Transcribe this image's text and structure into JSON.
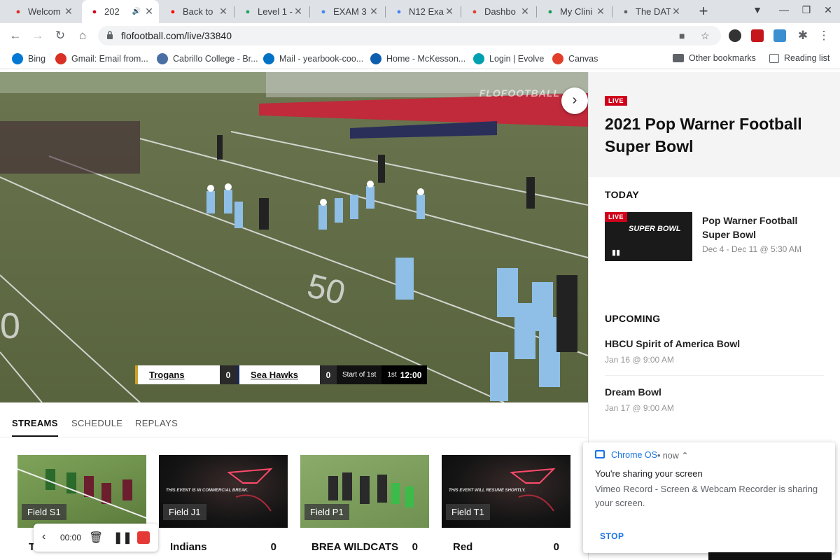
{
  "browser": {
    "tabs": [
      {
        "title": "Welcom",
        "favicon": "gmail-icon",
        "color": "#d93025"
      },
      {
        "title": "202",
        "favicon": "flosports-icon",
        "color": "#d0021b",
        "active": true,
        "audio": true
      },
      {
        "title": "Back to",
        "favicon": "youtube-icon",
        "color": "#ff0000"
      },
      {
        "title": "Level 1 -",
        "favicon": "drive-icon",
        "color": "#1fa463"
      },
      {
        "title": "EXAM 3",
        "favicon": "docs-icon",
        "color": "#4285f4"
      },
      {
        "title": "N12 Exa",
        "favicon": "docs-icon",
        "color": "#4285f4"
      },
      {
        "title": "Dashbo",
        "favicon": "canvas-icon",
        "color": "#e13f2b"
      },
      {
        "title": "My Clini",
        "favicon": "sheets-icon",
        "color": "#0f9d58"
      },
      {
        "title": "The DAT",
        "favicon": "globe-icon",
        "color": "#5f6368"
      }
    ],
    "new_tab_label": "+",
    "url": "flofootball.com/live/33840",
    "bookmarks": [
      {
        "label": "Bing",
        "icon": "bing-icon",
        "color": "#0078d4"
      },
      {
        "label": "Gmail: Email from...",
        "icon": "gmail-icon",
        "color": "#d93025"
      },
      {
        "label": "Cabrillo College - Br...",
        "icon": "cabrillo-icon",
        "color": "#4a6fa5"
      },
      {
        "label": "Mail - yearbook-coo...",
        "icon": "outlook-icon",
        "color": "#0072c6"
      },
      {
        "label": "Home - McKesson...",
        "icon": "mckesson-icon",
        "color": "#0d5eaf"
      },
      {
        "label": "Login | Evolve",
        "icon": "evolve-icon",
        "color": "#00a0b0"
      },
      {
        "label": "Canvas",
        "icon": "canvas-icon",
        "color": "#e13f2b"
      }
    ],
    "other_bookmarks": "Other bookmarks",
    "reading_list": "Reading list"
  },
  "video": {
    "watermark": "FLOFOOTBALL",
    "scorebug": {
      "team1": "Trogans",
      "score1": "0",
      "team2": "Sea Hawks",
      "score2": "0",
      "status": "Start of 1st",
      "period": "1st",
      "clock": "12:00"
    }
  },
  "panel": {
    "live_label": "LIVE",
    "event_title": "2021 Pop Warner Football Super Bowl",
    "today_label": "TODAY",
    "today_event": {
      "live_label": "LIVE",
      "thumb_text": "SUPER BOWL",
      "title": "Pop Warner Football Super Bowl",
      "date": "Dec 4 - Dec 11 @ 5:30 AM"
    },
    "upcoming_label": "UPCOMING",
    "upcoming": [
      {
        "title": "HBCU Spirit of America Bowl",
        "date": "Jan 16 @ 9:00 AM"
      },
      {
        "title": "Dream Bowl",
        "date": "Jan 17 @ 9:00 AM"
      }
    ]
  },
  "page_tabs": [
    "STREAMS",
    "SCHEDULE",
    "REPLAYS"
  ],
  "streams": [
    {
      "field": "Field S1",
      "team": "T",
      "score": "",
      "kind": "field"
    },
    {
      "field": "Field J1",
      "team": "Indians",
      "score": "0",
      "kind": "dark",
      "msg": "THIS EVENT IS IN COMMERCIAL BREAK."
    },
    {
      "field": "Field P1",
      "team": "BREA WILDCATS",
      "score": "0",
      "kind": "field"
    },
    {
      "field": "Field T1",
      "team": "Red",
      "score": "0",
      "kind": "dark",
      "msg": "THIS EVENT WILL RESUME SHORTLY."
    }
  ],
  "recorder": {
    "time": "00:00"
  },
  "notification": {
    "source": "Chrome OS",
    "when": "• now ⌃",
    "title": "You're sharing your screen",
    "body": "Vimeo Record - Screen & Webcam Recorder is sharing your screen.",
    "action": "STOP"
  }
}
